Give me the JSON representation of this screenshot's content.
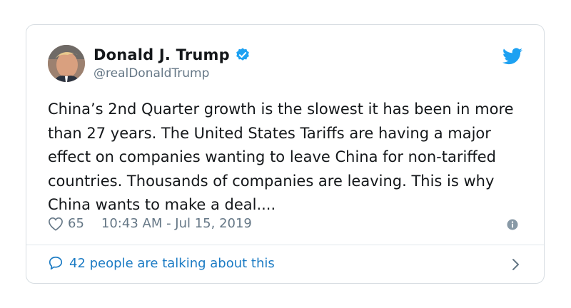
{
  "tweet": {
    "author_name": "Donald J. Trump",
    "handle": "@realDonaldTrump",
    "text": "China’s 2nd Quarter growth is the slowest it has been in more than 27 years. The United States Tariffs are having a major effect on companies wanting to leave China for non-tariffed countries. Thousands of companies are leaving. This is why China wants to make a deal....",
    "likes": "65",
    "timestamp": "10:43 AM - Jul 15, 2019",
    "talking": "42 people are talking about this"
  },
  "icons": {
    "verified": "verified-badge-icon",
    "bird": "twitter-bird-icon",
    "heart": "heart-outline-icon",
    "info": "info-icon",
    "bubble": "speech-bubble-icon",
    "chevron": "chevron-right-icon"
  },
  "colors": {
    "brand_blue": "#1da1f2",
    "link_blue": "#1b7bc4",
    "muted": "#657786",
    "text": "#14171a"
  }
}
